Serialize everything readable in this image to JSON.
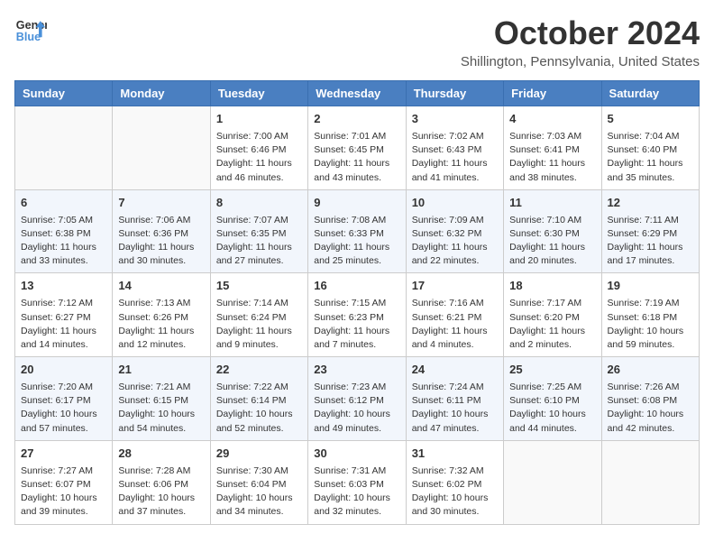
{
  "header": {
    "logo_line1": "General",
    "logo_line2": "Blue",
    "month": "October 2024",
    "location": "Shillington, Pennsylvania, United States"
  },
  "days_of_week": [
    "Sunday",
    "Monday",
    "Tuesday",
    "Wednesday",
    "Thursday",
    "Friday",
    "Saturday"
  ],
  "weeks": [
    [
      {
        "day": "",
        "info": ""
      },
      {
        "day": "",
        "info": ""
      },
      {
        "day": "1",
        "info": "Sunrise: 7:00 AM\nSunset: 6:46 PM\nDaylight: 11 hours and 46 minutes."
      },
      {
        "day": "2",
        "info": "Sunrise: 7:01 AM\nSunset: 6:45 PM\nDaylight: 11 hours and 43 minutes."
      },
      {
        "day": "3",
        "info": "Sunrise: 7:02 AM\nSunset: 6:43 PM\nDaylight: 11 hours and 41 minutes."
      },
      {
        "day": "4",
        "info": "Sunrise: 7:03 AM\nSunset: 6:41 PM\nDaylight: 11 hours and 38 minutes."
      },
      {
        "day": "5",
        "info": "Sunrise: 7:04 AM\nSunset: 6:40 PM\nDaylight: 11 hours and 35 minutes."
      }
    ],
    [
      {
        "day": "6",
        "info": "Sunrise: 7:05 AM\nSunset: 6:38 PM\nDaylight: 11 hours and 33 minutes."
      },
      {
        "day": "7",
        "info": "Sunrise: 7:06 AM\nSunset: 6:36 PM\nDaylight: 11 hours and 30 minutes."
      },
      {
        "day": "8",
        "info": "Sunrise: 7:07 AM\nSunset: 6:35 PM\nDaylight: 11 hours and 27 minutes."
      },
      {
        "day": "9",
        "info": "Sunrise: 7:08 AM\nSunset: 6:33 PM\nDaylight: 11 hours and 25 minutes."
      },
      {
        "day": "10",
        "info": "Sunrise: 7:09 AM\nSunset: 6:32 PM\nDaylight: 11 hours and 22 minutes."
      },
      {
        "day": "11",
        "info": "Sunrise: 7:10 AM\nSunset: 6:30 PM\nDaylight: 11 hours and 20 minutes."
      },
      {
        "day": "12",
        "info": "Sunrise: 7:11 AM\nSunset: 6:29 PM\nDaylight: 11 hours and 17 minutes."
      }
    ],
    [
      {
        "day": "13",
        "info": "Sunrise: 7:12 AM\nSunset: 6:27 PM\nDaylight: 11 hours and 14 minutes."
      },
      {
        "day": "14",
        "info": "Sunrise: 7:13 AM\nSunset: 6:26 PM\nDaylight: 11 hours and 12 minutes."
      },
      {
        "day": "15",
        "info": "Sunrise: 7:14 AM\nSunset: 6:24 PM\nDaylight: 11 hours and 9 minutes."
      },
      {
        "day": "16",
        "info": "Sunrise: 7:15 AM\nSunset: 6:23 PM\nDaylight: 11 hours and 7 minutes."
      },
      {
        "day": "17",
        "info": "Sunrise: 7:16 AM\nSunset: 6:21 PM\nDaylight: 11 hours and 4 minutes."
      },
      {
        "day": "18",
        "info": "Sunrise: 7:17 AM\nSunset: 6:20 PM\nDaylight: 11 hours and 2 minutes."
      },
      {
        "day": "19",
        "info": "Sunrise: 7:19 AM\nSunset: 6:18 PM\nDaylight: 10 hours and 59 minutes."
      }
    ],
    [
      {
        "day": "20",
        "info": "Sunrise: 7:20 AM\nSunset: 6:17 PM\nDaylight: 10 hours and 57 minutes."
      },
      {
        "day": "21",
        "info": "Sunrise: 7:21 AM\nSunset: 6:15 PM\nDaylight: 10 hours and 54 minutes."
      },
      {
        "day": "22",
        "info": "Sunrise: 7:22 AM\nSunset: 6:14 PM\nDaylight: 10 hours and 52 minutes."
      },
      {
        "day": "23",
        "info": "Sunrise: 7:23 AM\nSunset: 6:12 PM\nDaylight: 10 hours and 49 minutes."
      },
      {
        "day": "24",
        "info": "Sunrise: 7:24 AM\nSunset: 6:11 PM\nDaylight: 10 hours and 47 minutes."
      },
      {
        "day": "25",
        "info": "Sunrise: 7:25 AM\nSunset: 6:10 PM\nDaylight: 10 hours and 44 minutes."
      },
      {
        "day": "26",
        "info": "Sunrise: 7:26 AM\nSunset: 6:08 PM\nDaylight: 10 hours and 42 minutes."
      }
    ],
    [
      {
        "day": "27",
        "info": "Sunrise: 7:27 AM\nSunset: 6:07 PM\nDaylight: 10 hours and 39 minutes."
      },
      {
        "day": "28",
        "info": "Sunrise: 7:28 AM\nSunset: 6:06 PM\nDaylight: 10 hours and 37 minutes."
      },
      {
        "day": "29",
        "info": "Sunrise: 7:30 AM\nSunset: 6:04 PM\nDaylight: 10 hours and 34 minutes."
      },
      {
        "day": "30",
        "info": "Sunrise: 7:31 AM\nSunset: 6:03 PM\nDaylight: 10 hours and 32 minutes."
      },
      {
        "day": "31",
        "info": "Sunrise: 7:32 AM\nSunset: 6:02 PM\nDaylight: 10 hours and 30 minutes."
      },
      {
        "day": "",
        "info": ""
      },
      {
        "day": "",
        "info": ""
      }
    ]
  ]
}
